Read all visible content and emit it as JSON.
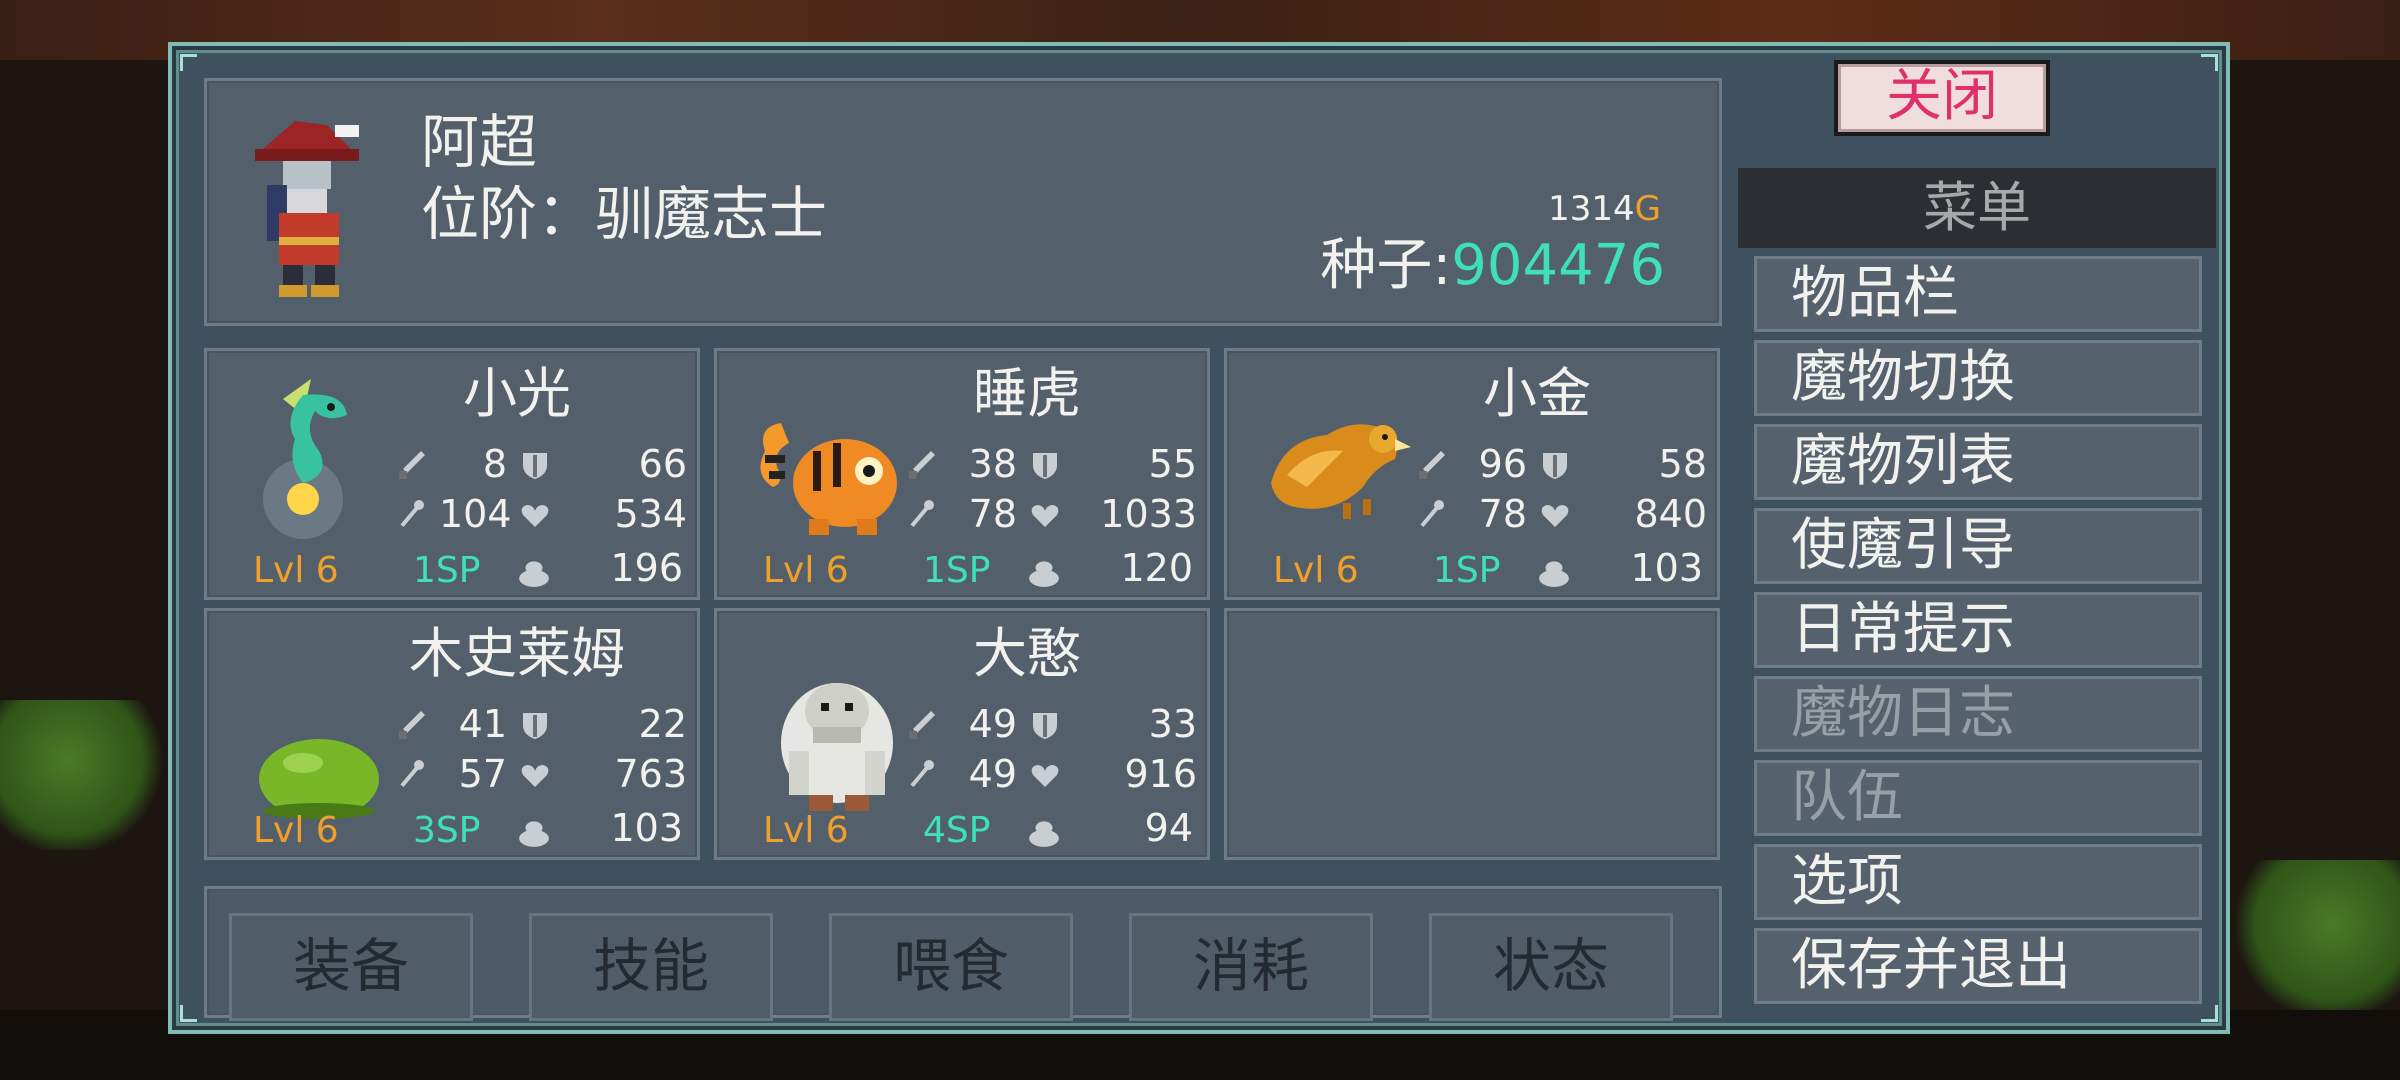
{
  "player": {
    "name": "阿超",
    "rank": "位阶：驯魔志士",
    "gold_value": "1314",
    "gold_unit": "G",
    "seeds_label": "种子:",
    "seeds_value": "904476"
  },
  "monsters": [
    {
      "name": "小光",
      "attack": "8",
      "defense": "66",
      "magic": "104",
      "hp": "534",
      "lvl": "Lvl 6",
      "sp": "1SP",
      "food": "196"
    },
    {
      "name": "睡虎",
      "attack": "38",
      "defense": "55",
      "magic": "78",
      "hp": "1033",
      "lvl": "Lvl 6",
      "sp": "1SP",
      "food": "120"
    },
    {
      "name": "小金",
      "attack": "96",
      "defense": "58",
      "magic": "78",
      "hp": "840",
      "lvl": "Lvl 6",
      "sp": "1SP",
      "food": "103"
    },
    {
      "name": "木史莱姆",
      "attack": "41",
      "defense": "22",
      "magic": "57",
      "hp": "763",
      "lvl": "Lvl 6",
      "sp": "3SP",
      "food": "103"
    },
    {
      "name": "大憨",
      "attack": "49",
      "defense": "33",
      "magic": "49",
      "hp": "916",
      "lvl": "Lvl 6",
      "sp": "4SP",
      "food": "94"
    }
  ],
  "tabs": [
    "装备",
    "技能",
    "喂食",
    "消耗",
    "状态"
  ],
  "menu": {
    "close_label": "关闭",
    "title": "菜单",
    "items": [
      {
        "label": "物品栏",
        "enabled": true
      },
      {
        "label": "魔物切换",
        "enabled": true
      },
      {
        "label": "魔物列表",
        "enabled": true
      },
      {
        "label": "使魔引导",
        "enabled": true
      },
      {
        "label": "日常提示",
        "enabled": true
      },
      {
        "label": "魔物日志",
        "enabled": false
      },
      {
        "label": "队伍",
        "enabled": false
      },
      {
        "label": "选项",
        "enabled": true
      },
      {
        "label": "保存并退出",
        "enabled": true
      }
    ]
  },
  "colors": {
    "panel": "#3f505f",
    "accent_teal": "#3fe0b8",
    "gold": "#f0a02a",
    "close_text": "#e0306a"
  },
  "icons": {
    "stat_attack": "sword-icon",
    "stat_defense": "shield-icon",
    "stat_magic": "wand-icon",
    "stat_hp": "heart-icon",
    "stat_food": "food-icon"
  }
}
